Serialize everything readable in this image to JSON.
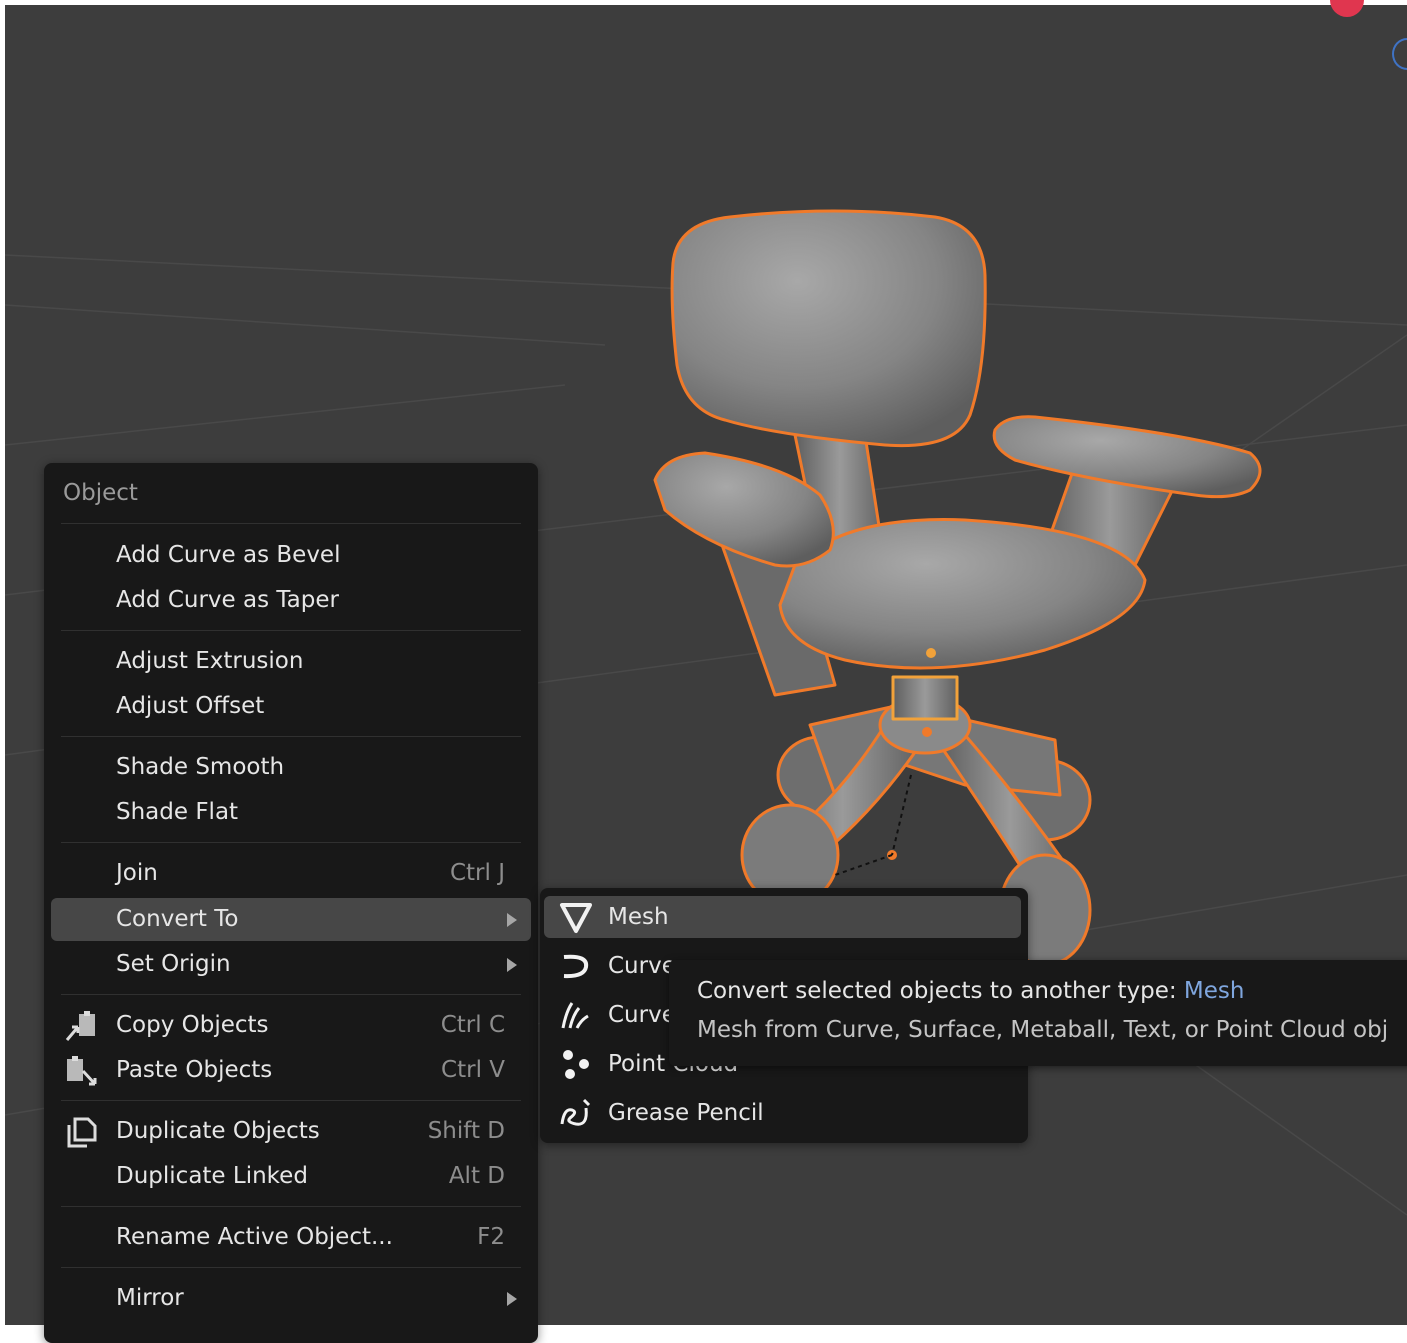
{
  "menu": {
    "title": "Object",
    "items": [
      {
        "label": "Add Curve as Bevel"
      },
      {
        "label": "Add Curve as Taper"
      },
      {
        "label": "Adjust Extrusion"
      },
      {
        "label": "Adjust Offset"
      },
      {
        "label": "Shade Smooth"
      },
      {
        "label": "Shade Flat"
      },
      {
        "label": "Join",
        "shortcut": "Ctrl J"
      },
      {
        "label": "Convert To",
        "submenu": true,
        "active": true
      },
      {
        "label": "Set Origin",
        "submenu": true
      },
      {
        "label": "Copy Objects",
        "shortcut": "Ctrl C",
        "icon": "copy-icon"
      },
      {
        "label": "Paste Objects",
        "shortcut": "Ctrl V",
        "icon": "paste-icon"
      },
      {
        "label": "Duplicate Objects",
        "shortcut": "Shift D",
        "icon": "duplicate-icon"
      },
      {
        "label": "Duplicate Linked",
        "shortcut": "Alt D"
      },
      {
        "label": "Rename Active Object...",
        "shortcut": "F2"
      },
      {
        "label": "Mirror",
        "submenu": true
      }
    ]
  },
  "submenu": {
    "items": [
      {
        "label": "Mesh",
        "icon": "mesh-icon",
        "active": true
      },
      {
        "label": "Curve",
        "icon": "curve-icon"
      },
      {
        "label": "Curves",
        "icon": "curves-icon"
      },
      {
        "label": "Point Cloud",
        "icon": "point-cloud-icon"
      },
      {
        "label": "Grease Pencil",
        "icon": "grease-pencil-icon"
      }
    ]
  },
  "tooltip": {
    "line1_prefix": "Convert selected objects to another type: ",
    "line1_highlight": "Mesh",
    "line2": "Mesh from Curve, Surface, Metaball, Text, or Point Cloud obj"
  },
  "colors": {
    "viewport_bg": "#3d3d3d",
    "menu_bg": "#181818",
    "highlight": "#474747",
    "selection_outline": "#f07a2a",
    "tooltip_accent": "#7fa6de"
  }
}
